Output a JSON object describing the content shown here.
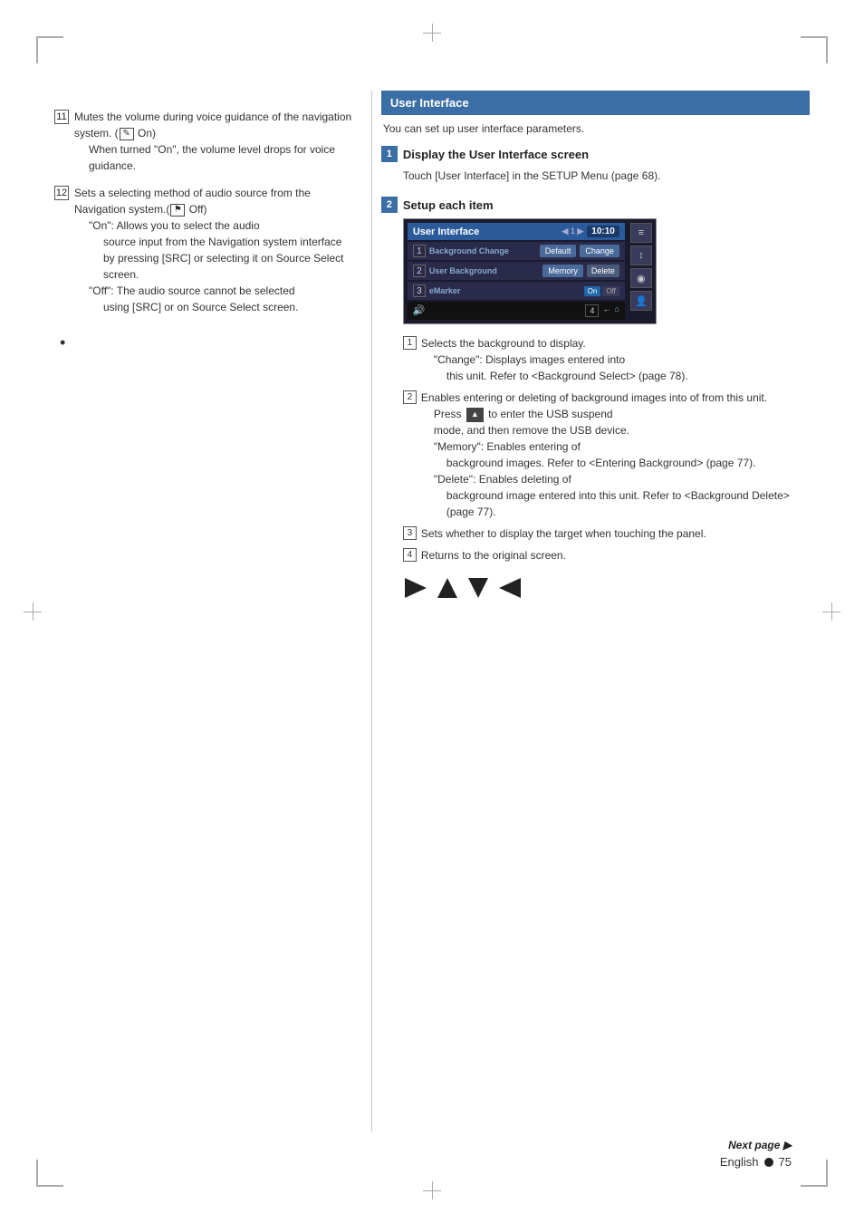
{
  "corners": [
    "tl",
    "tr",
    "bl",
    "br"
  ],
  "left_col": {
    "item11": {
      "num": "11",
      "text": "Mutes the volume during voice guidance of the navigation system. (",
      "icon1": "On",
      "text2": " On)",
      "text3": "When turned \"On\", the volume level drops for voice guidance."
    },
    "item12": {
      "num": "12",
      "text": "Sets a selecting method of audio source from the Navigation system.(",
      "icon1": "Off",
      "text2": " Off)",
      "on_label": "\"On\":",
      "on_text": "Allows you to select the audio source input from the Navigation system interface by pressing [SRC] or selecting it on Source Select screen.",
      "off_label": "\"Off\":",
      "off_text": "The audio source cannot be selected using [SRC] or on Source Select screen."
    }
  },
  "right_col": {
    "section_title": "User Interface",
    "intro": "You can set up user interface parameters.",
    "step1": {
      "num": "1",
      "title": "Display the User Interface screen",
      "desc": "Touch [User Interface] in the SETUP Menu (page 68)."
    },
    "step2": {
      "num": "2",
      "title": "Setup each item",
      "ui": {
        "window_title": "User Interface",
        "time": "10:10",
        "page_indicator": "1",
        "rows": [
          {
            "section": "Background Change",
            "num": "1",
            "btn1": "Default",
            "btn2": "Change"
          },
          {
            "section": "User Background",
            "num": "2",
            "btn1": "Memory",
            "btn2": "Delete"
          },
          {
            "section": "eMarker",
            "num": "3",
            "toggle_on": "On",
            "toggle_off": "Off"
          }
        ]
      },
      "desc_items": [
        {
          "num": "1",
          "text": "Selects the background to display.",
          "indent1": "\"Change\": Displays images entered into this unit. Refer to <Background Select> (page 78)."
        },
        {
          "num": "2",
          "text": "Enables entering or deleting of background images into of from this unit.",
          "sub1_label": "Press",
          "sub1_icon": "▲",
          "sub1_text": " to enter the USB suspend mode, and then remove the USB device.",
          "memory_label": "\"Memory\":",
          "memory_text": "Enables entering of background images. Refer to <Entering Background> (page 77).",
          "delete_label": "\"Delete\":",
          "delete_text": "Enables deleting of background image entered into this unit. Refer to <Background Delete> (page 77)."
        },
        {
          "num": "3",
          "text": "Sets whether to display the target when touching the panel."
        },
        {
          "num": "4",
          "text": "Returns to the original screen."
        }
      ]
    }
  },
  "nav_arrows": [
    "▶",
    "▲",
    "▼",
    "◀"
  ],
  "footer": {
    "next_page": "Next page ▶",
    "language": "English",
    "page_number": "75"
  }
}
